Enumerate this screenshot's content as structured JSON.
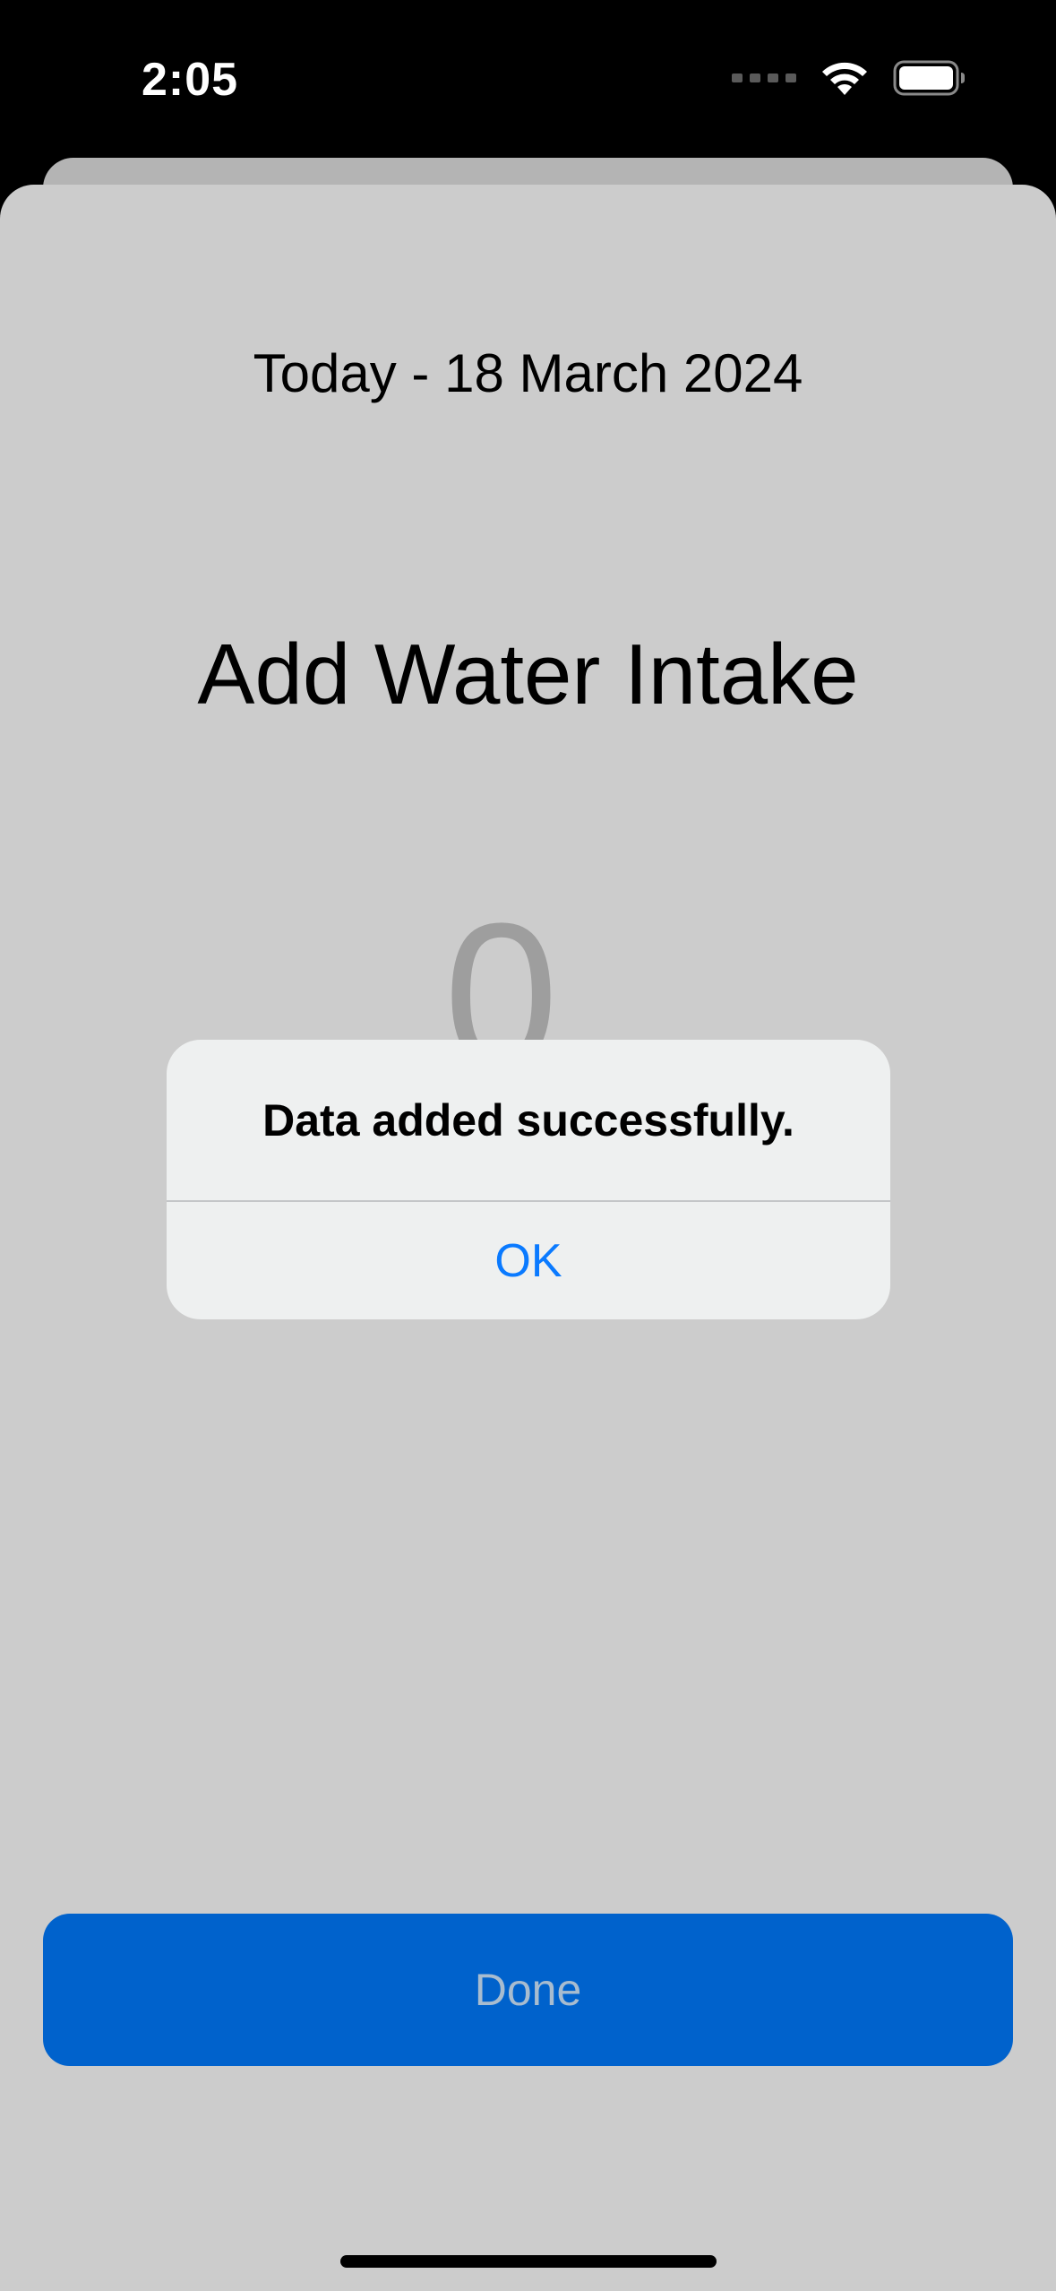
{
  "status_bar": {
    "time": "2:05"
  },
  "icons": {
    "wifi": "wifi-icon",
    "battery": "battery-icon",
    "signal": "cellular-signal-icon"
  },
  "sheet": {
    "date": "Today - 18 March 2024",
    "title": "Add Water Intake",
    "value": "0",
    "done_label": "Done"
  },
  "alert": {
    "message": "Data added successfully.",
    "ok_label": "OK"
  },
  "colors": {
    "accent_blue": "#0062cc",
    "alert_button_blue": "#0a7aff",
    "sheet_background": "#cccccc"
  }
}
